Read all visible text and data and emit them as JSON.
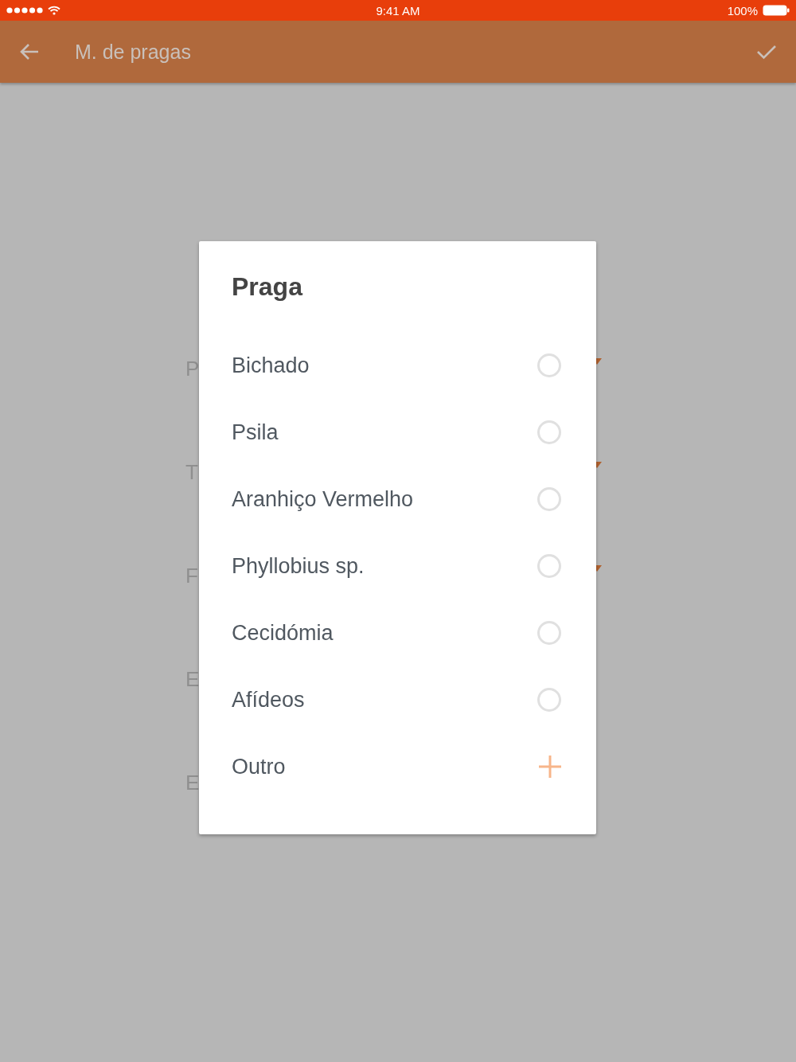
{
  "status_bar": {
    "time": "9:41 AM",
    "battery": "100%"
  },
  "app_bar": {
    "title": "M. de pragas"
  },
  "form_fields": [
    {
      "label": "P",
      "kind": "select"
    },
    {
      "label": "T",
      "kind": "select"
    },
    {
      "label": "F",
      "kind": "select"
    },
    {
      "label": "E",
      "kind": "text"
    },
    {
      "label": "E",
      "kind": "text"
    }
  ],
  "dialog": {
    "title": "Praga",
    "options": [
      {
        "label": "Bichado",
        "kind": "radio",
        "selected": false
      },
      {
        "label": "Psila",
        "kind": "radio",
        "selected": false
      },
      {
        "label": "Aranhiço Vermelho",
        "kind": "radio",
        "selected": false
      },
      {
        "label": "Phyllobius sp.",
        "kind": "radio",
        "selected": false
      },
      {
        "label": "Cecidómia",
        "kind": "radio",
        "selected": false
      },
      {
        "label": "Afídeos",
        "kind": "radio",
        "selected": false
      },
      {
        "label": "Outro",
        "kind": "add"
      }
    ]
  }
}
